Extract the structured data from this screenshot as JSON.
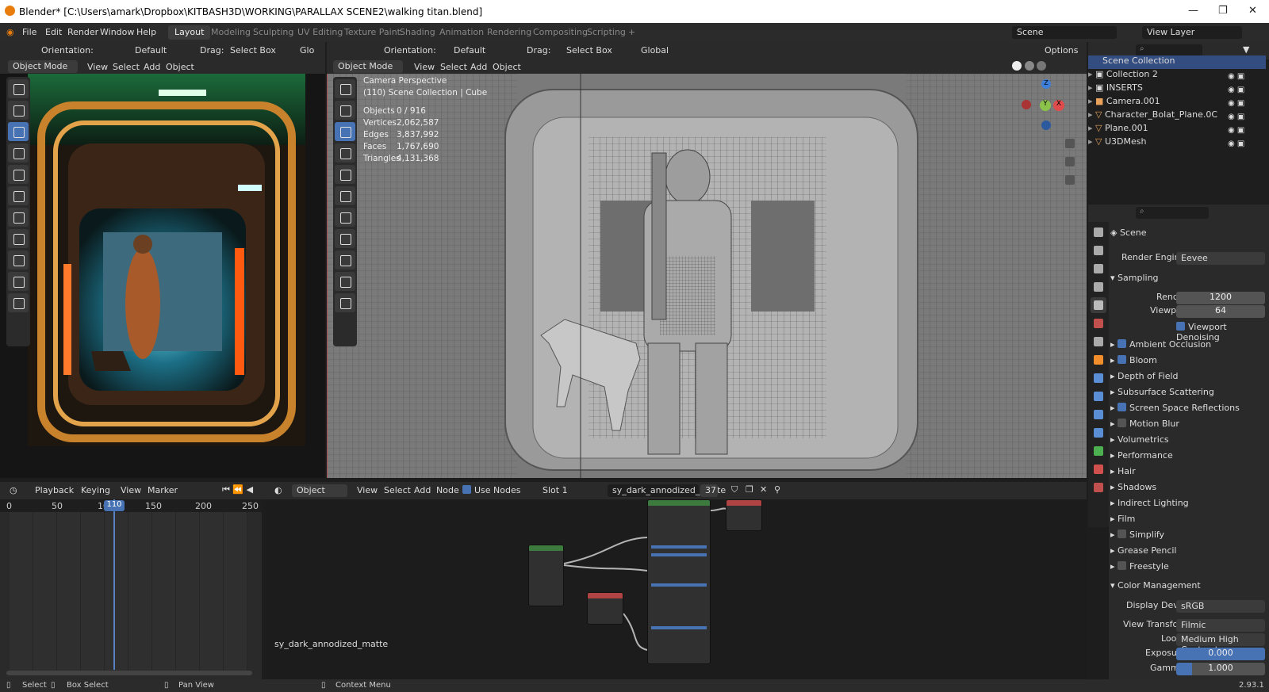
{
  "window": {
    "title": "Blender* [C:\\Users\\amark\\Dropbox\\KITBASH3D\\WORKING\\PARALLAX SCENE2\\walking titan.blend]",
    "minimize": "—",
    "maximize": "❐",
    "close": "✕"
  },
  "menu": {
    "items": [
      "File",
      "Edit",
      "Render",
      "Window",
      "Help"
    ]
  },
  "workspaces": [
    "Layout",
    "Modeling",
    "Sculpting",
    "UV Editing",
    "Texture Paint",
    "Shading",
    "Animation",
    "Rendering",
    "Compositing",
    "Scripting",
    "+"
  ],
  "scene": {
    "label": "Scene",
    "view_layer": "View Layer"
  },
  "left_viewport": {
    "orientation_label": "Orientation:",
    "orientation": "Default",
    "drag_label": "Drag:",
    "drag": "Select Box",
    "mode": "Object Mode",
    "menus": [
      "View",
      "Select",
      "Add",
      "Object"
    ],
    "glo": "Glo"
  },
  "main_viewport": {
    "orientation_label": "Orientation:",
    "orientation": "Default",
    "drag_label": "Drag:",
    "drag": "Select Box",
    "transform": "Global",
    "options": "Options",
    "mode": "Object Mode",
    "menus": [
      "View",
      "Select",
      "Add",
      "Object"
    ],
    "info": {
      "line1": "Camera Perspective",
      "line2": "(110) Scene Collection | Cube"
    },
    "stats": [
      {
        "label": "Objects",
        "value": "0 / 916"
      },
      {
        "label": "Vertices",
        "value": "2,062,587"
      },
      {
        "label": "Edges",
        "value": "3,837,992"
      },
      {
        "label": "Faces",
        "value": "1,767,690"
      },
      {
        "label": "Triangles",
        "value": "4,131,368"
      }
    ],
    "gizmo": {
      "x": "X",
      "y": "Y",
      "z": "Z"
    }
  },
  "outliner": {
    "root": "Scene Collection",
    "items": [
      "Collection 2",
      "INSERTS",
      "Camera.001",
      "Character_Bolat_Plane.0C",
      "Plane.001",
      "U3DMesh"
    ]
  },
  "properties": {
    "scene_label": "Scene",
    "render_engine_label": "Render Engine",
    "render_engine": "Eevee",
    "sampling": {
      "title": "Sampling",
      "render_label": "Render",
      "render_value": "1200",
      "viewport_label": "Viewport",
      "viewport_value": "64",
      "denoise": "Viewport Denoising"
    },
    "panels": [
      {
        "label": "Ambient Occlusion",
        "check": true
      },
      {
        "label": "Bloom",
        "check": true
      },
      {
        "label": "Depth of Field",
        "check": null
      },
      {
        "label": "Subsurface Scattering",
        "check": null
      },
      {
        "label": "Screen Space Reflections",
        "check": true
      },
      {
        "label": "Motion Blur",
        "check": false
      },
      {
        "label": "Volumetrics",
        "check": null
      },
      {
        "label": "Performance",
        "check": null
      },
      {
        "label": "Hair",
        "check": null
      },
      {
        "label": "Shadows",
        "check": null
      },
      {
        "label": "Indirect Lighting",
        "check": null
      },
      {
        "label": "Film",
        "check": null
      },
      {
        "label": "Simplify",
        "check": false
      },
      {
        "label": "Grease Pencil",
        "check": null
      },
      {
        "label": "Freestyle",
        "check": false
      }
    ],
    "color_management": {
      "title": "Color Management",
      "display_device_label": "Display Device",
      "display_device": "sRGB",
      "view_transform_label": "View Transform",
      "view_transform": "Filmic",
      "look_label": "Look",
      "look": "Medium High Contrast",
      "exposure_label": "Exposure",
      "exposure": "0.000",
      "gamma_label": "Gamma",
      "gamma": "1.000"
    }
  },
  "timeline": {
    "playback": "Playback",
    "keying": "Keying",
    "view": "View",
    "marker": "Marker",
    "ticks": [
      "0",
      "50",
      "100",
      "150",
      "200",
      "250"
    ],
    "current_frame": "110"
  },
  "node_editor": {
    "object": "Object",
    "menus": [
      "View",
      "Select",
      "Add",
      "Node"
    ],
    "use_nodes": "Use Nodes",
    "slot": "Slot 1",
    "material": "sy_dark_annodized_matte",
    "users": "37",
    "material_label": "sy_dark_annodized_matte"
  },
  "statusbar": {
    "select": "Select",
    "box_select": "Box Select",
    "pan_view": "Pan View",
    "context_menu": "Context Menu",
    "version": "2.93.1"
  }
}
